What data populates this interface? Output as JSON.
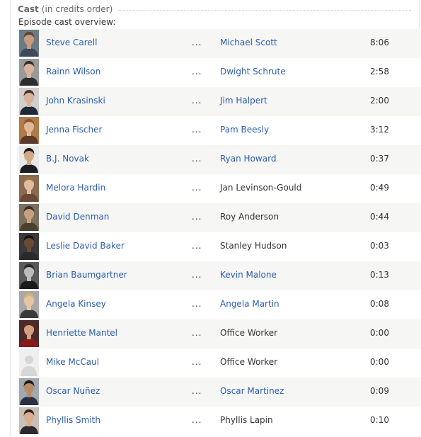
{
  "section": {
    "title": "Cast",
    "subtitle": "(in credits order)",
    "overview_label": "Episode cast overview:",
    "ellipsis": "..."
  },
  "colors": {
    "link": "#2a5db0",
    "row_shade": "#f6f6f5",
    "text": "#333333"
  },
  "cast": [
    {
      "actor": "Steve Carell",
      "character": "Michael Scott",
      "character_linked": true,
      "time": "8:06",
      "photo": {
        "skin": "#c89a80",
        "hair": "#5a4636",
        "shirt": "#3b4a5c",
        "bg": "#6c7a86"
      }
    },
    {
      "actor": "Rainn Wilson",
      "character": "Dwight Schrute",
      "character_linked": true,
      "time": "2:58",
      "photo": {
        "skin": "#d8b49c",
        "hair": "#3a2d22",
        "shirt": "#2d2d2d",
        "bg": "#9a9a9a"
      }
    },
    {
      "actor": "John Krasinski",
      "character": "Jim Halpert",
      "character_linked": true,
      "time": "2:00",
      "photo": {
        "skin": "#d9b29a",
        "hair": "#4a3526",
        "shirt": "#1e2a3a",
        "bg": "#cfcfcf"
      }
    },
    {
      "actor": "Jenna Fischer",
      "character": "Pam Beesly",
      "character_linked": true,
      "time": "3:12",
      "photo": {
        "skin": "#e0b896",
        "hair": "#8a5a30",
        "shirt": "#5a3a2a",
        "bg": "#b07a4a"
      }
    },
    {
      "actor": "B.J. Novak",
      "character": "Ryan Howard",
      "character_linked": true,
      "time": "0:37",
      "photo": {
        "skin": "#d0a888",
        "hair": "#1e1a18",
        "shirt": "#1c1c22",
        "bg": "#e8e8e8"
      }
    },
    {
      "actor": "Melora Hardin",
      "character": "Jan Levinson-Gould",
      "character_linked": false,
      "time": "0:49",
      "photo": {
        "skin": "#e2bca0",
        "hair": "#a07040",
        "shirt": "#6a4a36",
        "bg": "#8a6a50"
      }
    },
    {
      "actor": "David Denman",
      "character": "Roy Anderson",
      "character_linked": false,
      "time": "0:44",
      "photo": {
        "skin": "#c8a080",
        "hair": "#3a3028",
        "shirt": "#4a4030",
        "bg": "#7a7060"
      }
    },
    {
      "actor": "Leslie David Baker",
      "character": "Stanley Hudson",
      "character_linked": false,
      "time": "0:03",
      "photo": {
        "skin": "#6a4a36",
        "hair": "#1a1410",
        "shirt": "#2a2a2a",
        "bg": "#3a3a3a"
      }
    },
    {
      "actor": "Brian Baumgartner",
      "character": "Kevin Malone",
      "character_linked": true,
      "time": "0:13",
      "photo": {
        "skin": "#bcbcbc",
        "hair": "#2a2a2a",
        "shirt": "#1a1a1a",
        "bg": "#5a5a5a"
      }
    },
    {
      "actor": "Angela Kinsey",
      "character": "Angela Martin",
      "character_linked": true,
      "time": "0:08",
      "photo": {
        "skin": "#e6c4a4",
        "hair": "#d6b46a",
        "shirt": "#3a3a3a",
        "bg": "#a8a8a8"
      }
    },
    {
      "actor": "Henriette Mantel",
      "character": "Office Worker",
      "character_linked": false,
      "time": "0:00",
      "photo": {
        "skin": "#d0a080",
        "hair": "#5a2a1a",
        "shirt": "#8a1a1a",
        "bg": "#4a2a2a"
      }
    },
    {
      "actor": "Mike McCaul",
      "character": "Office Worker",
      "character_linked": false,
      "time": "0:00",
      "photo": {
        "placeholder": true,
        "skin": "#d6d6d6",
        "hair": "#d6d6d6",
        "shirt": "#d6d6d6",
        "bg": "#efefef"
      }
    },
    {
      "actor": "Oscar Nuñez",
      "character": "Oscar Martinez",
      "character_linked": true,
      "time": "0:09",
      "photo": {
        "skin": "#b88c6a",
        "hair": "#1e1814",
        "shirt": "#2a3040",
        "bg": "#a0a8b0"
      }
    },
    {
      "actor": "Phyllis Smith",
      "character": "Phyllis Lapin",
      "character_linked": false,
      "time": "0:10",
      "photo": {
        "skin": "#d8ae90",
        "hair": "#3a2418",
        "shirt": "#2a2a30",
        "bg": "#c8c0b8"
      }
    }
  ]
}
